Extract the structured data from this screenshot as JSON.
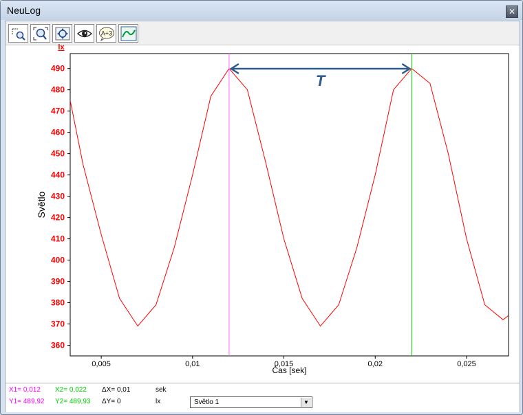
{
  "window": {
    "title": "NeuLog",
    "close_glyph": "✕"
  },
  "toolbar": {
    "buttons": [
      {
        "name": "zoom-area-button",
        "icon": "zoom-area-icon"
      },
      {
        "name": "zoom-fit-button",
        "icon": "zoom-fit-icon"
      },
      {
        "name": "zoom-axis-button",
        "icon": "zoom-axis-icon"
      },
      {
        "name": "view-button",
        "icon": "eye-icon"
      },
      {
        "name": "function-button",
        "icon": "function-bubble-icon",
        "label": "A+3"
      },
      {
        "name": "curve-button",
        "icon": "curve-icon"
      }
    ]
  },
  "chart_data": {
    "type": "line",
    "unit_label": "lx",
    "ylabel": "Světlo",
    "xlabel": "Čas [sek]",
    "xlim": [
      0.0033,
      0.0273
    ],
    "ylim": [
      355,
      497
    ],
    "x_ticks": [
      0.005,
      0.01,
      0.015,
      0.02,
      0.025
    ],
    "x_tick_labels": [
      "0,005",
      "0,01",
      "0,015",
      "0,02",
      "0,025"
    ],
    "y_ticks": [
      360,
      370,
      380,
      390,
      400,
      410,
      420,
      430,
      440,
      450,
      460,
      470,
      480,
      490
    ],
    "series": [
      {
        "color": "#ff0000",
        "x": [
          0.0033,
          0.004,
          0.005,
          0.006,
          0.007,
          0.008,
          0.009,
          0.01,
          0.011,
          0.012,
          0.013,
          0.014,
          0.015,
          0.016,
          0.017,
          0.018,
          0.019,
          0.02,
          0.021,
          0.022,
          0.023,
          0.024,
          0.025,
          0.026,
          0.027,
          0.0273
        ],
        "y": [
          475,
          445,
          412,
          382,
          369,
          379,
          406,
          440,
          477,
          490,
          480,
          446,
          410,
          382,
          369,
          379,
          406,
          440,
          480,
          490,
          483,
          450,
          410,
          379,
          372,
          374
        ]
      }
    ],
    "cursors": [
      {
        "x": 0.012,
        "color": "#ff66ff"
      },
      {
        "x": 0.022,
        "color": "#00cc00"
      }
    ],
    "annotation": {
      "label": "T",
      "color": "#2f5b8a",
      "x_from": 0.012,
      "x_to": 0.022
    },
    "grid": false
  },
  "footer": {
    "x1": "X1= 0,012",
    "x2": "X2= 0,022",
    "dx": "ΔX= 0,01",
    "x_unit": "sek",
    "y1": "Y1= 489,92",
    "y2": "Y2= 489,93",
    "dy": "ΔY= 0",
    "y_unit": "lx",
    "dropdown_value": "Světlo  1",
    "colors": {
      "cursor1": "#ff00ff",
      "cursor2": "#00cc00"
    }
  }
}
